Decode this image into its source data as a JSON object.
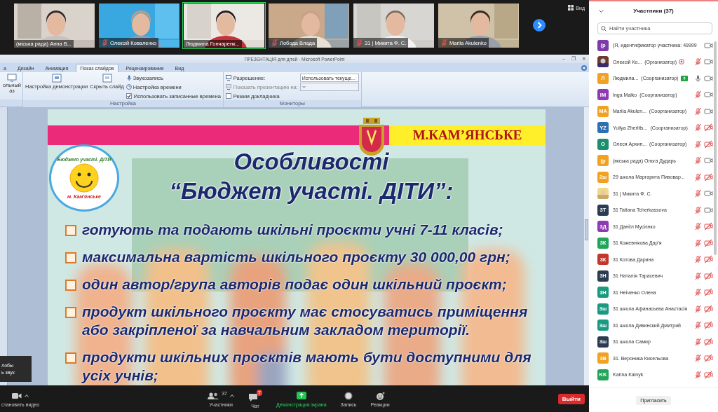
{
  "video_strip": {
    "tiles": [
      {
        "name": "(міська рада) Анна В...",
        "muted": false,
        "speaking": false
      },
      {
        "name": "Олексій Коваленко",
        "muted": true,
        "speaking": false
      },
      {
        "name": "Людмила Гончаренк...",
        "muted": false,
        "speaking": true
      },
      {
        "name": "Лобода Влада",
        "muted": true,
        "speaking": false
      },
      {
        "name": "31 | Микита Ф. С.",
        "muted": true,
        "speaking": false
      },
      {
        "name": "Mariia Akulenko",
        "muted": true,
        "speaking": false
      }
    ],
    "view_button": "Вид"
  },
  "powerpoint": {
    "title": "ПРЕЗЕНТАЦІЯ для дітей - Microsoft PowerPoint",
    "window_controls": [
      "–",
      "❐",
      "✕"
    ],
    "tabs": [
      {
        "label": "а",
        "selected": false
      },
      {
        "label": "Дизайн",
        "selected": false
      },
      {
        "label": "Анимация",
        "selected": false
      },
      {
        "label": "Показ слайдов",
        "selected": true
      },
      {
        "label": "Рецензирование",
        "selected": false
      },
      {
        "label": "Вид",
        "selected": false
      }
    ],
    "ribbon": {
      "cut_button": "ольный аз",
      "groups": [
        {
          "label": "Настройка",
          "big_buttons": [
            "Настройка демонстрации",
            "Скрыть слайд"
          ],
          "items": [
            {
              "kind": "icon",
              "label": "Звукозапись"
            },
            {
              "kind": "icon",
              "label": "Настройка времени"
            },
            {
              "kind": "checkbox",
              "label": "Использовать записанные времена",
              "checked": true
            }
          ]
        },
        {
          "label": "Мониторы",
          "items": [
            {
              "kind": "dropdown",
              "label": "Разрешение:",
              "value": "Использовать текуще...",
              "disabled": false
            },
            {
              "kind": "dropdown",
              "label": "Показать презентацию на:",
              "disabled": true
            },
            {
              "kind": "checkbox",
              "label": "Режим докладчика",
              "checked": false
            }
          ]
        }
      ]
    },
    "slide": {
      "city": "М.КАМ’ЯНСЬКЕ",
      "logo_top": "Бюджет участі. ДІТИ",
      "logo_bottom": "м. Кам'янське",
      "title": "Особливості",
      "subtitle": "“Бюджет участі. ДІТИ”:",
      "bullets": [
        "готують та подають шкільні проєкти учні 7-11 класів;",
        "максимальна вартість шкільного проєкту 30 000,00 грн;",
        "один автор/група авторів подає один шкільний проєкт;",
        "продукт шкільного проєкту має стосуватись приміщення або закріпленої за навчальним закладом території.",
        "продукти шкільних проєктів мають бути доступними для усіх учнів;"
      ]
    }
  },
  "toast": [
    "лобы",
    "ь звук"
  ],
  "toolbar": {
    "video": "становить видео",
    "participants": "Участники",
    "participants_count": "37",
    "chat": "Чат",
    "chat_badge": "7",
    "share": "Демонстрация экрана",
    "record": "Запись",
    "reactions": "Реакции",
    "leave": "Выйти"
  },
  "participants_panel": {
    "title": "Участники (37)",
    "search": {
      "placeholder": "Найти участника"
    },
    "rows": [
      {
        "kind": "initials",
        "avatar": "(р",
        "color": "#7d3aa8",
        "name": "(Я, идентификатор участника: 49999",
        "video_on": true
      },
      {
        "name": "Олексій Ко...",
        "role": "(Организатор)",
        "recording": true,
        "mic_muted": true,
        "video_on": true
      },
      {
        "kind": "initials",
        "avatar": "Л",
        "color": "#f2a120",
        "name": "Людмила...",
        "role": "(Соорганизатор)",
        "sharing": true,
        "mic_muted": false,
        "video_on": true
      },
      {
        "kind": "initials",
        "avatar": "IM",
        "color": "#8e3ab0",
        "name": "Inga Malko",
        "role": "(Соорганизатор)",
        "mic_muted": true,
        "video_on": true
      },
      {
        "kind": "initials",
        "avatar": "MA",
        "color": "#f2a120",
        "name": "Mariia Akulen...",
        "role": "(Соорганизатор)",
        "mic_muted": true,
        "video_on": true
      },
      {
        "kind": "initials",
        "avatar": "YZ",
        "color": "#2d6fb5",
        "name": "Yuliya Zherlits...",
        "role": "(Соорганизатор)",
        "mic_muted": true,
        "video_on": false
      },
      {
        "kind": "initials",
        "avatar": "О",
        "color": "#1a8f6e",
        "name": "Олеся Архип...",
        "role": "(Соорганизатор)",
        "mic_muted": true,
        "video_on": false
      },
      {
        "kind": "initials",
        "avatar": "(р",
        "color": "#f2a120",
        "name": "(міська рада) Ольга Дударь",
        "mic_muted": true,
        "video_on": true
      },
      {
        "kind": "initials",
        "avatar": "2ш",
        "color": "#f2a120",
        "name": "29 школа Маргарита Пивовар...",
        "mic_muted": true,
        "video_on": false
      },
      {
        "name": "31 | Микита Ф. С.",
        "mic_muted": true,
        "video_on": true
      },
      {
        "kind": "initials",
        "avatar": "3T",
        "color": "#2b3b52",
        "name": "31 Tatiana Tcherkassova",
        "mic_muted": true,
        "video_on": true
      },
      {
        "kind": "initials",
        "avatar": "3Д",
        "color": "#8e3ab0",
        "name": "31 Даніїл Мусієнко",
        "mic_muted": true,
        "video_on": false
      },
      {
        "kind": "initials",
        "avatar": "3К",
        "color": "#22a55a",
        "name": "31 Кожевнікова Дар'я",
        "mic_muted": true,
        "video_on": false
      },
      {
        "kind": "initials",
        "avatar": "3К",
        "color": "#c0392b",
        "name": "31 Котова Дарина",
        "mic_muted": true,
        "video_on": false
      },
      {
        "kind": "initials",
        "avatar": "3Н",
        "color": "#2b3b52",
        "name": "31 Наталія Тарасевич",
        "mic_muted": true,
        "video_on": false
      },
      {
        "kind": "initials",
        "avatar": "3Н",
        "color": "#1a9a80",
        "name": "31 Неіченко Олена",
        "mic_muted": true,
        "video_on": false
      },
      {
        "kind": "initials",
        "avatar": "3ш",
        "color": "#1a9a80",
        "name": "31 школа Афанасьєва Анастасія",
        "mic_muted": true,
        "video_on": false
      },
      {
        "kind": "initials",
        "avatar": "3ш",
        "color": "#1a9a80",
        "name": "31 школа Дивинский Дмитрий",
        "mic_muted": true,
        "video_on": false
      },
      {
        "kind": "initials",
        "avatar": "3ш",
        "color": "#2b3b52",
        "name": "31 школа Самир",
        "mic_muted": true,
        "video_on": false
      },
      {
        "kind": "initials",
        "avatar": "3В",
        "color": "#f2a120",
        "name": "31. Вероника Кисельова",
        "mic_muted": true,
        "video_on": false
      },
      {
        "kind": "initials",
        "avatar": "KK",
        "color": "#22a55a",
        "name": "Karina Kalnyk",
        "mic_muted": true,
        "video_on": false
      }
    ],
    "invite_button": "Пригласить"
  }
}
